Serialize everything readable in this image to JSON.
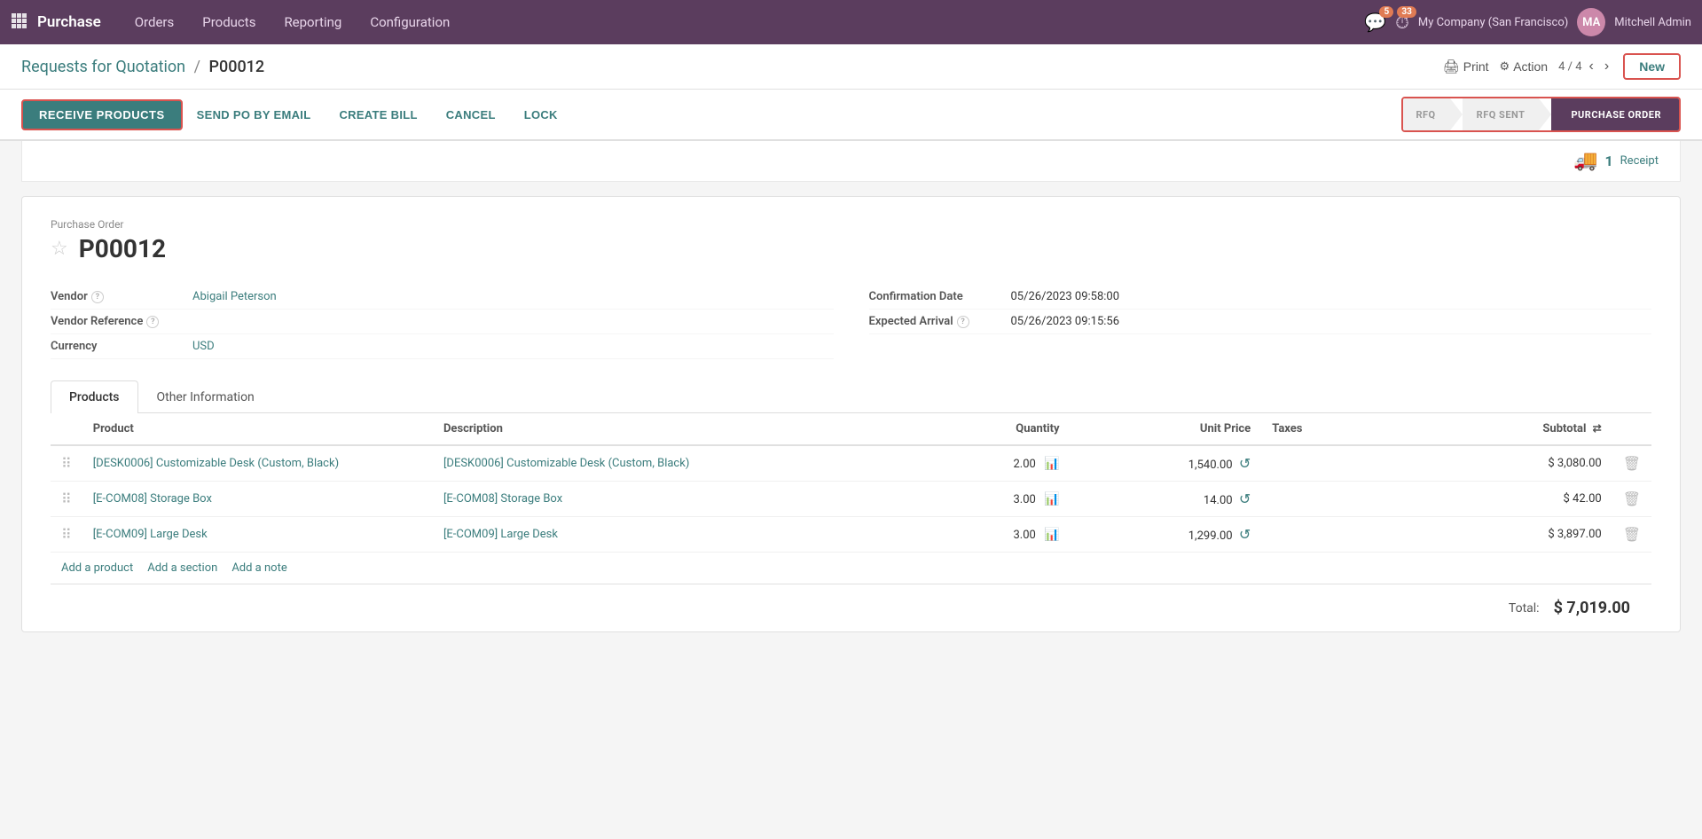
{
  "topnav": {
    "brand": "Purchase",
    "items": [
      "Orders",
      "Products",
      "Reporting",
      "Configuration"
    ],
    "badge_chat": "5",
    "badge_clock": "33",
    "company": "My Company (San Francisco)",
    "user": "Mitchell Admin",
    "avatar_initials": "MA"
  },
  "breadcrumb": {
    "base": "Requests for Quotation",
    "separator": "/",
    "current": "P00012"
  },
  "header_actions": {
    "print_label": "Print",
    "action_label": "Action",
    "pager": "4 / 4",
    "new_label": "New"
  },
  "action_buttons": {
    "receive_products": "RECEIVE PRODUCTS",
    "send_po": "SEND PO BY EMAIL",
    "create_bill": "CREATE BILL",
    "cancel": "CANCEL",
    "lock": "LOCK"
  },
  "pipeline": {
    "rfq": "RFQ",
    "rfq_sent": "RFQ SENT",
    "purchase_order": "PURCHASE ORDER"
  },
  "receipt": {
    "count": "1",
    "label": "Receipt"
  },
  "form": {
    "form_label": "Purchase Order",
    "order_number": "P00012",
    "vendor_label": "Vendor",
    "vendor_value": "Abigail Peterson",
    "vendor_ref_label": "Vendor Reference",
    "currency_label": "Currency",
    "currency_value": "USD",
    "confirm_date_label": "Confirmation Date",
    "confirm_date_value": "05/26/2023 09:58:00",
    "expected_arrival_label": "Expected Arrival",
    "expected_arrival_value": "05/26/2023 09:15:56"
  },
  "tabs": {
    "products": "Products",
    "other_info": "Other Information"
  },
  "table": {
    "headers": {
      "product": "Product",
      "description": "Description",
      "quantity": "Quantity",
      "unit_price": "Unit Price",
      "taxes": "Taxes",
      "subtotal": "Subtotal"
    },
    "rows": [
      {
        "product": "[DESK0006] Customizable Desk (Custom, Black)",
        "description": "[DESK0006] Customizable Desk (Custom, Black)",
        "quantity": "2.00",
        "unit_price": "1,540.00",
        "taxes": "",
        "subtotal": "$ 3,080.00"
      },
      {
        "product": "[E-COM08] Storage Box",
        "description": "[E-COM08] Storage Box",
        "quantity": "3.00",
        "unit_price": "14.00",
        "taxes": "",
        "subtotal": "$ 42.00"
      },
      {
        "product": "[E-COM09] Large Desk",
        "description": "[E-COM09] Large Desk",
        "quantity": "3.00",
        "unit_price": "1,299.00",
        "taxes": "",
        "subtotal": "$ 3,897.00"
      }
    ],
    "add_product": "Add a product",
    "add_section": "Add a section",
    "add_note": "Add a note",
    "total_label": "Total:",
    "total_value": "$ 7,019.00"
  }
}
